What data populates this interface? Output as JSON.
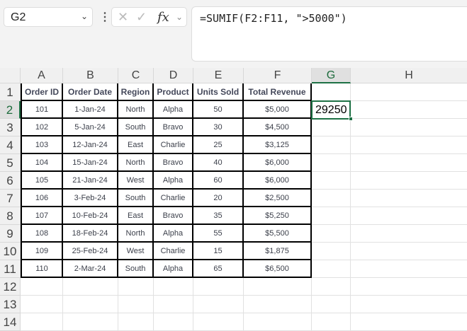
{
  "name_box": "G2",
  "formula": "=SUMIF(F2:F11, \">5000\")",
  "columns": [
    "A",
    "B",
    "C",
    "D",
    "E",
    "F",
    "G",
    "H"
  ],
  "rows": [
    "1",
    "2",
    "3",
    "4",
    "5",
    "6",
    "7",
    "8",
    "9",
    "10",
    "11",
    "12",
    "13",
    "14"
  ],
  "headers": [
    "Order ID",
    "Order Date",
    "Region",
    "Product",
    "Units Sold",
    "Total Revenue"
  ],
  "data": [
    [
      "101",
      "1-Jan-24",
      "North",
      "Alpha",
      "50",
      "$5,000"
    ],
    [
      "102",
      "5-Jan-24",
      "South",
      "Bravo",
      "30",
      "$4,500"
    ],
    [
      "103",
      "12-Jan-24",
      "East",
      "Charlie",
      "25",
      "$3,125"
    ],
    [
      "104",
      "15-Jan-24",
      "North",
      "Bravo",
      "40",
      "$6,000"
    ],
    [
      "105",
      "21-Jan-24",
      "West",
      "Alpha",
      "60",
      "$6,000"
    ],
    [
      "106",
      "3-Feb-24",
      "South",
      "Charlie",
      "20",
      "$2,500"
    ],
    [
      "107",
      "10-Feb-24",
      "East",
      "Bravo",
      "35",
      "$5,250"
    ],
    [
      "108",
      "18-Feb-24",
      "North",
      "Alpha",
      "55",
      "$5,500"
    ],
    [
      "109",
      "25-Feb-24",
      "West",
      "Charlie",
      "15",
      "$1,875"
    ],
    [
      "110",
      "2-Mar-24",
      "South",
      "Alpha",
      "65",
      "$6,500"
    ]
  ],
  "result": "29250",
  "accent": "#1e7145"
}
